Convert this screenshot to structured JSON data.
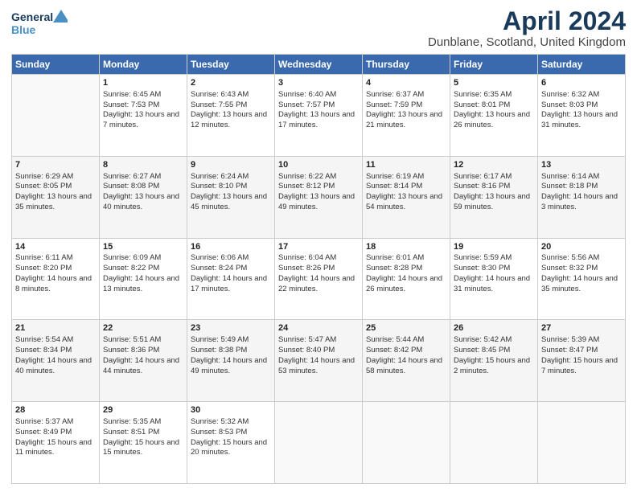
{
  "logo": {
    "line1": "General",
    "line2": "Blue"
  },
  "title": "April 2024",
  "subtitle": "Dunblane, Scotland, United Kingdom",
  "days_of_week": [
    "Sunday",
    "Monday",
    "Tuesday",
    "Wednesday",
    "Thursday",
    "Friday",
    "Saturday"
  ],
  "weeks": [
    [
      {
        "day": "",
        "sunrise": "",
        "sunset": "",
        "daylight": ""
      },
      {
        "day": "1",
        "sunrise": "Sunrise: 6:45 AM",
        "sunset": "Sunset: 7:53 PM",
        "daylight": "Daylight: 13 hours and 7 minutes."
      },
      {
        "day": "2",
        "sunrise": "Sunrise: 6:43 AM",
        "sunset": "Sunset: 7:55 PM",
        "daylight": "Daylight: 13 hours and 12 minutes."
      },
      {
        "day": "3",
        "sunrise": "Sunrise: 6:40 AM",
        "sunset": "Sunset: 7:57 PM",
        "daylight": "Daylight: 13 hours and 17 minutes."
      },
      {
        "day": "4",
        "sunrise": "Sunrise: 6:37 AM",
        "sunset": "Sunset: 7:59 PM",
        "daylight": "Daylight: 13 hours and 21 minutes."
      },
      {
        "day": "5",
        "sunrise": "Sunrise: 6:35 AM",
        "sunset": "Sunset: 8:01 PM",
        "daylight": "Daylight: 13 hours and 26 minutes."
      },
      {
        "day": "6",
        "sunrise": "Sunrise: 6:32 AM",
        "sunset": "Sunset: 8:03 PM",
        "daylight": "Daylight: 13 hours and 31 minutes."
      }
    ],
    [
      {
        "day": "7",
        "sunrise": "Sunrise: 6:29 AM",
        "sunset": "Sunset: 8:05 PM",
        "daylight": "Daylight: 13 hours and 35 minutes."
      },
      {
        "day": "8",
        "sunrise": "Sunrise: 6:27 AM",
        "sunset": "Sunset: 8:08 PM",
        "daylight": "Daylight: 13 hours and 40 minutes."
      },
      {
        "day": "9",
        "sunrise": "Sunrise: 6:24 AM",
        "sunset": "Sunset: 8:10 PM",
        "daylight": "Daylight: 13 hours and 45 minutes."
      },
      {
        "day": "10",
        "sunrise": "Sunrise: 6:22 AM",
        "sunset": "Sunset: 8:12 PM",
        "daylight": "Daylight: 13 hours and 49 minutes."
      },
      {
        "day": "11",
        "sunrise": "Sunrise: 6:19 AM",
        "sunset": "Sunset: 8:14 PM",
        "daylight": "Daylight: 13 hours and 54 minutes."
      },
      {
        "day": "12",
        "sunrise": "Sunrise: 6:17 AM",
        "sunset": "Sunset: 8:16 PM",
        "daylight": "Daylight: 13 hours and 59 minutes."
      },
      {
        "day": "13",
        "sunrise": "Sunrise: 6:14 AM",
        "sunset": "Sunset: 8:18 PM",
        "daylight": "Daylight: 14 hours and 3 minutes."
      }
    ],
    [
      {
        "day": "14",
        "sunrise": "Sunrise: 6:11 AM",
        "sunset": "Sunset: 8:20 PM",
        "daylight": "Daylight: 14 hours and 8 minutes."
      },
      {
        "day": "15",
        "sunrise": "Sunrise: 6:09 AM",
        "sunset": "Sunset: 8:22 PM",
        "daylight": "Daylight: 14 hours and 13 minutes."
      },
      {
        "day": "16",
        "sunrise": "Sunrise: 6:06 AM",
        "sunset": "Sunset: 8:24 PM",
        "daylight": "Daylight: 14 hours and 17 minutes."
      },
      {
        "day": "17",
        "sunrise": "Sunrise: 6:04 AM",
        "sunset": "Sunset: 8:26 PM",
        "daylight": "Daylight: 14 hours and 22 minutes."
      },
      {
        "day": "18",
        "sunrise": "Sunrise: 6:01 AM",
        "sunset": "Sunset: 8:28 PM",
        "daylight": "Daylight: 14 hours and 26 minutes."
      },
      {
        "day": "19",
        "sunrise": "Sunrise: 5:59 AM",
        "sunset": "Sunset: 8:30 PM",
        "daylight": "Daylight: 14 hours and 31 minutes."
      },
      {
        "day": "20",
        "sunrise": "Sunrise: 5:56 AM",
        "sunset": "Sunset: 8:32 PM",
        "daylight": "Daylight: 14 hours and 35 minutes."
      }
    ],
    [
      {
        "day": "21",
        "sunrise": "Sunrise: 5:54 AM",
        "sunset": "Sunset: 8:34 PM",
        "daylight": "Daylight: 14 hours and 40 minutes."
      },
      {
        "day": "22",
        "sunrise": "Sunrise: 5:51 AM",
        "sunset": "Sunset: 8:36 PM",
        "daylight": "Daylight: 14 hours and 44 minutes."
      },
      {
        "day": "23",
        "sunrise": "Sunrise: 5:49 AM",
        "sunset": "Sunset: 8:38 PM",
        "daylight": "Daylight: 14 hours and 49 minutes."
      },
      {
        "day": "24",
        "sunrise": "Sunrise: 5:47 AM",
        "sunset": "Sunset: 8:40 PM",
        "daylight": "Daylight: 14 hours and 53 minutes."
      },
      {
        "day": "25",
        "sunrise": "Sunrise: 5:44 AM",
        "sunset": "Sunset: 8:42 PM",
        "daylight": "Daylight: 14 hours and 58 minutes."
      },
      {
        "day": "26",
        "sunrise": "Sunrise: 5:42 AM",
        "sunset": "Sunset: 8:45 PM",
        "daylight": "Daylight: 15 hours and 2 minutes."
      },
      {
        "day": "27",
        "sunrise": "Sunrise: 5:39 AM",
        "sunset": "Sunset: 8:47 PM",
        "daylight": "Daylight: 15 hours and 7 minutes."
      }
    ],
    [
      {
        "day": "28",
        "sunrise": "Sunrise: 5:37 AM",
        "sunset": "Sunset: 8:49 PM",
        "daylight": "Daylight: 15 hours and 11 minutes."
      },
      {
        "day": "29",
        "sunrise": "Sunrise: 5:35 AM",
        "sunset": "Sunset: 8:51 PM",
        "daylight": "Daylight: 15 hours and 15 minutes."
      },
      {
        "day": "30",
        "sunrise": "Sunrise: 5:32 AM",
        "sunset": "Sunset: 8:53 PM",
        "daylight": "Daylight: 15 hours and 20 minutes."
      },
      {
        "day": "",
        "sunrise": "",
        "sunset": "",
        "daylight": ""
      },
      {
        "day": "",
        "sunrise": "",
        "sunset": "",
        "daylight": ""
      },
      {
        "day": "",
        "sunrise": "",
        "sunset": "",
        "daylight": ""
      },
      {
        "day": "",
        "sunrise": "",
        "sunset": "",
        "daylight": ""
      }
    ]
  ]
}
